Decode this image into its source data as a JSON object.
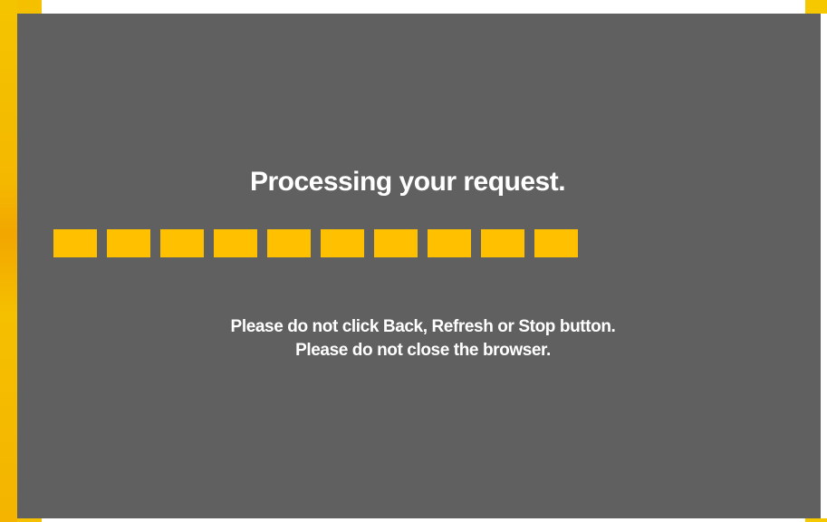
{
  "dialog": {
    "title": "Processing your request.",
    "progress_segments_visible": 10,
    "warning_line_1": "Please do not click Back, Refresh or Stop button.",
    "warning_line_2": "Please do not close the browser."
  },
  "colors": {
    "overlay": "#606060",
    "progress_segment": "#ffc000",
    "accent_edge": "#f5c000",
    "text": "#ffffff"
  }
}
